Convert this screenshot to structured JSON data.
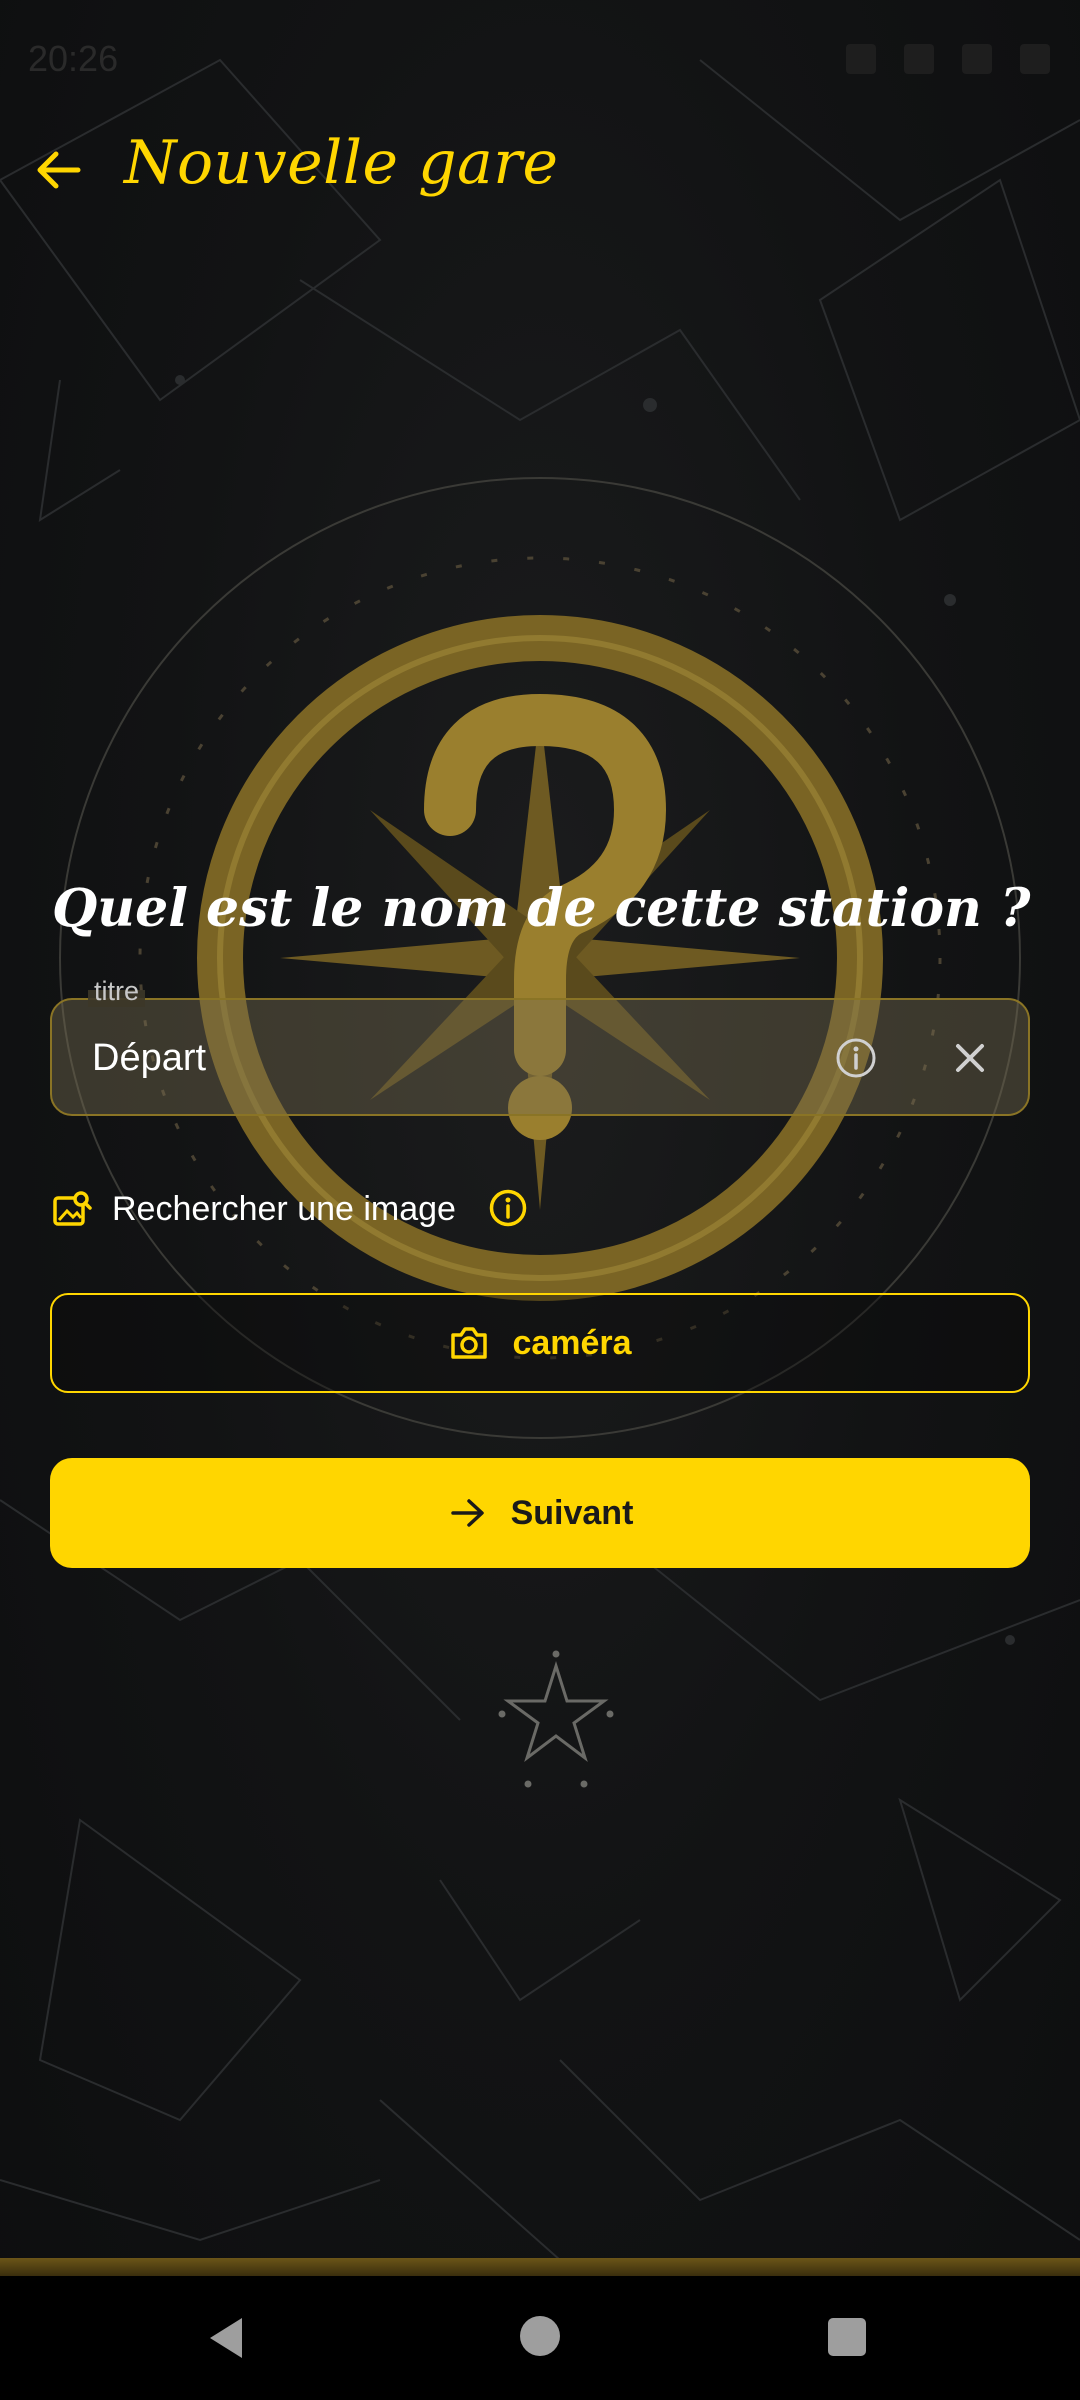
{
  "status_bar": {
    "time": "20:26"
  },
  "app_bar": {
    "title": "Nouvelle gare",
    "back_icon": "arrow-left-icon"
  },
  "form": {
    "question": "Quel est le nom de cette station ?",
    "title_field": {
      "label": "titre",
      "value": "Départ",
      "info_icon": "info-icon",
      "clear_icon": "close-icon"
    },
    "image_search": {
      "label": "Rechercher une image",
      "icon": "image-search-icon",
      "info_icon": "info-icon"
    },
    "camera_button": {
      "label": "caméra",
      "icon": "camera-icon"
    },
    "next_button": {
      "label": "Suivant",
      "icon": "arrow-right-icon"
    }
  },
  "nav_bar": {
    "back": "triangle-back-icon",
    "home": "circle-home-icon",
    "recents": "square-recents-icon"
  },
  "colors": {
    "accent": "#ffd600",
    "background": "#101112",
    "field_border": "#8a7425",
    "emblem_gold": "#8a6f22"
  }
}
